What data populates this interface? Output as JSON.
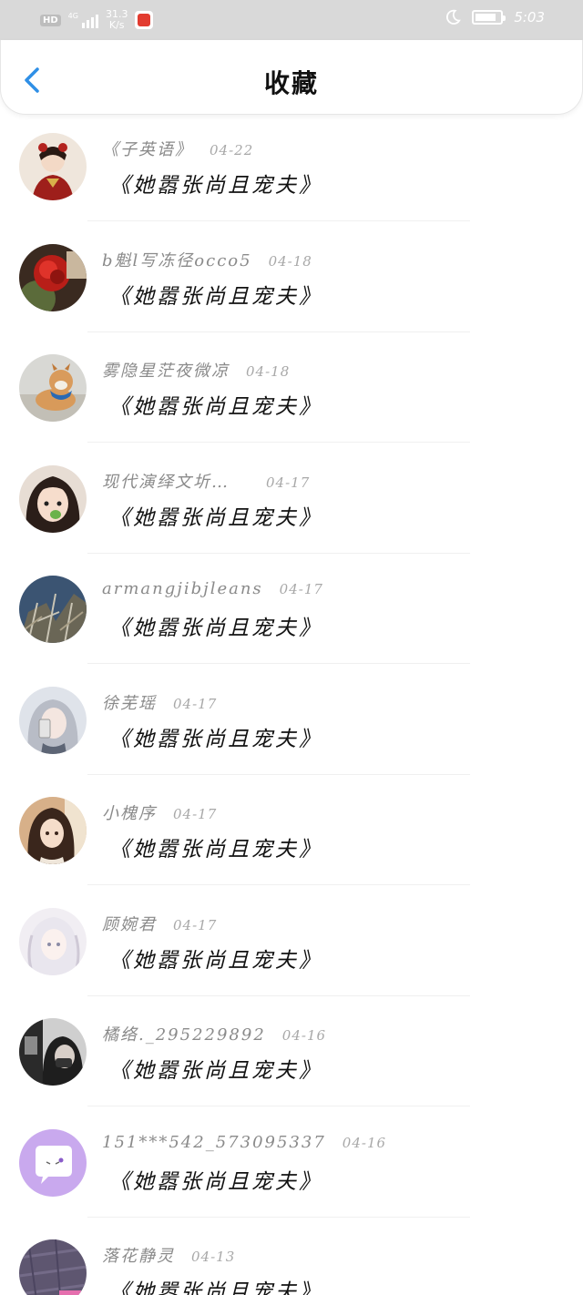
{
  "status_bar": {
    "hd": "HD",
    "network": "4G",
    "speed_value": "31.3",
    "speed_unit": "K/s",
    "time": "5:03"
  },
  "nav": {
    "title": "收藏",
    "back_icon": "chevron-left-icon"
  },
  "colors": {
    "accent": "#2f8fe6",
    "status_bar_bg": "#d9d9d9"
  },
  "favorites": [
    {
      "name": "《子英语》",
      "date": "04-22",
      "book": "《她嚣张尚且宠夫》",
      "avatar": "girl-red-dress"
    },
    {
      "name": "b魁l写冻径occo5",
      "date": "04-18",
      "book": "《她嚣张尚且宠夫》",
      "avatar": "red-rose"
    },
    {
      "name": "雾隐星茫夜微凉",
      "date": "04-18",
      "book": "《她嚣张尚且宠夫》",
      "avatar": "shiba-dog"
    },
    {
      "name": "现代演绎文圻…",
      "date": "04-17",
      "book": "《她嚣张尚且宠夫》",
      "avatar": "child-face"
    },
    {
      "name": "armangjibjleans",
      "date": "04-17",
      "book": "《她嚣张尚且宠夫》",
      "avatar": "winter-trees"
    },
    {
      "name": "徐芜瑶",
      "date": "04-17",
      "book": "《她嚣张尚且宠夫》",
      "avatar": "silver-hair-girl"
    },
    {
      "name": "小槐序",
      "date": "04-17",
      "book": "《她嚣张尚且宠夫》",
      "avatar": "anime-girl"
    },
    {
      "name": "顾婉君",
      "date": "04-17",
      "book": "《她嚣张尚且宠夫》",
      "avatar": "white-hair-girl"
    },
    {
      "name": "橘络._295229892",
      "date": "04-16",
      "book": "《她嚣张尚且宠夫》",
      "avatar": "dark-selfie"
    },
    {
      "name": "151***542_573095337",
      "date": "04-16",
      "book": "《她嚣张尚且宠夫》",
      "avatar": "purple-chat-bubble"
    },
    {
      "name": "落花静灵",
      "date": "04-13",
      "book": "《她嚣张尚且宠夫》",
      "avatar": "purple-texture"
    }
  ]
}
